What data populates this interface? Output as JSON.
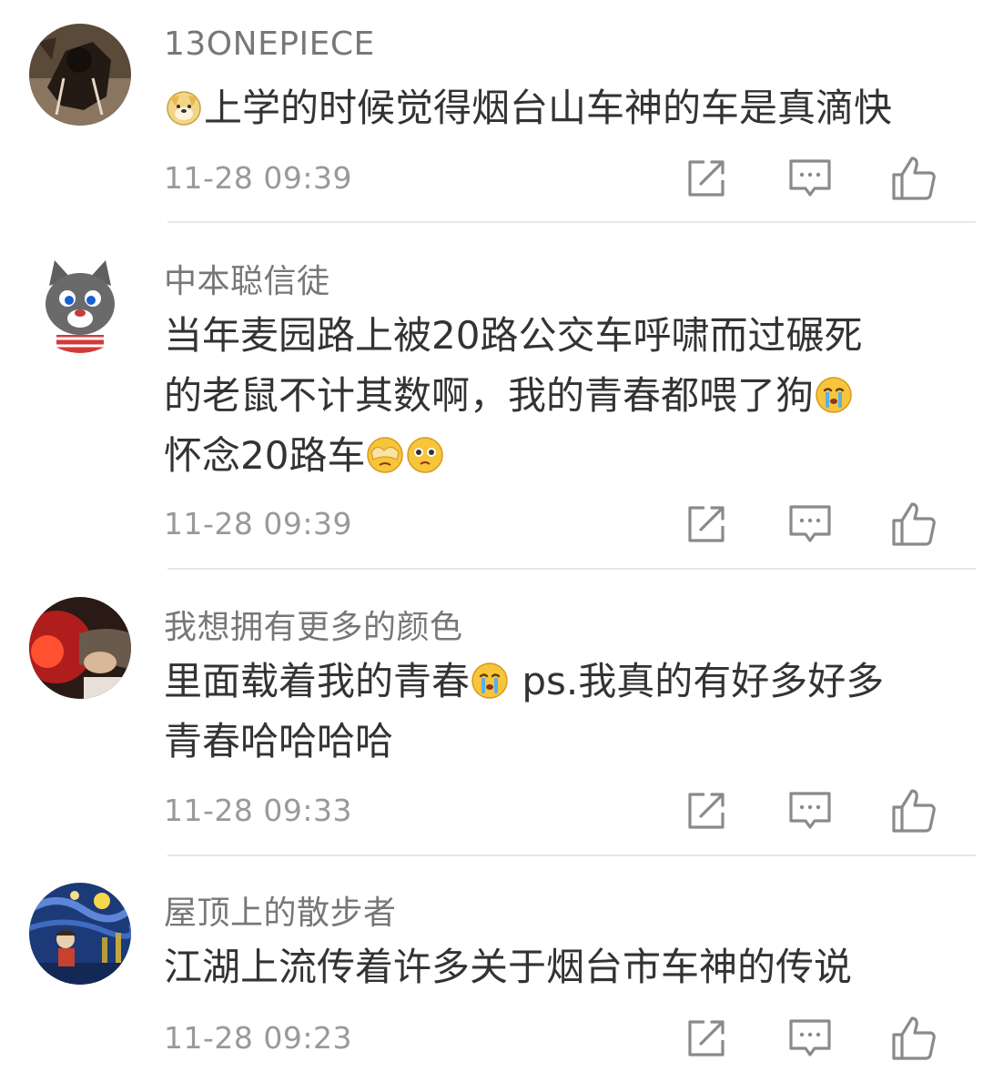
{
  "comments": [
    {
      "username": "13ONEPIECE",
      "lines": [
        "上学的时候觉得烟台山车神的车是真滴快"
      ],
      "time": "11-28 09:39",
      "avatar": "dark-creature-avatar",
      "emojis": [
        "doge-icon"
      ]
    },
    {
      "username": "中本聪信徒",
      "lines": [
        "当年麦园路上被20路公交车呼啸而过碾死",
        "的老鼠不计其数啊，我的青春都喂了狗",
        "怀念20路车"
      ],
      "time": "11-28 09:39",
      "avatar": "gray-cat-avatar",
      "emojis": [
        "crying-face-icon",
        "facepalm-face-icon",
        "pleading-face-icon"
      ]
    },
    {
      "username": "我想拥有更多的颜色",
      "lines": [
        "里面载着我的青春",
        " ps.我真的有好多好多",
        "青春哈哈哈哈"
      ],
      "time": "11-28 09:33",
      "avatar": "red-light-photo-avatar",
      "emojis": [
        "crying-face-icon"
      ]
    },
    {
      "username": "屋顶上的散步者",
      "lines": [
        "江湖上流传着许多关于烟台市车神的传说"
      ],
      "time": "11-28 09:23",
      "avatar": "starry-night-avatar",
      "emojis": []
    }
  ],
  "actions": [
    "share-icon",
    "comment-icon",
    "like-icon"
  ],
  "colors": {
    "text": "#333333",
    "meta": "#999999",
    "username": "#777777",
    "icon": "#8a8a8a",
    "divider": "#e6e6e6"
  }
}
